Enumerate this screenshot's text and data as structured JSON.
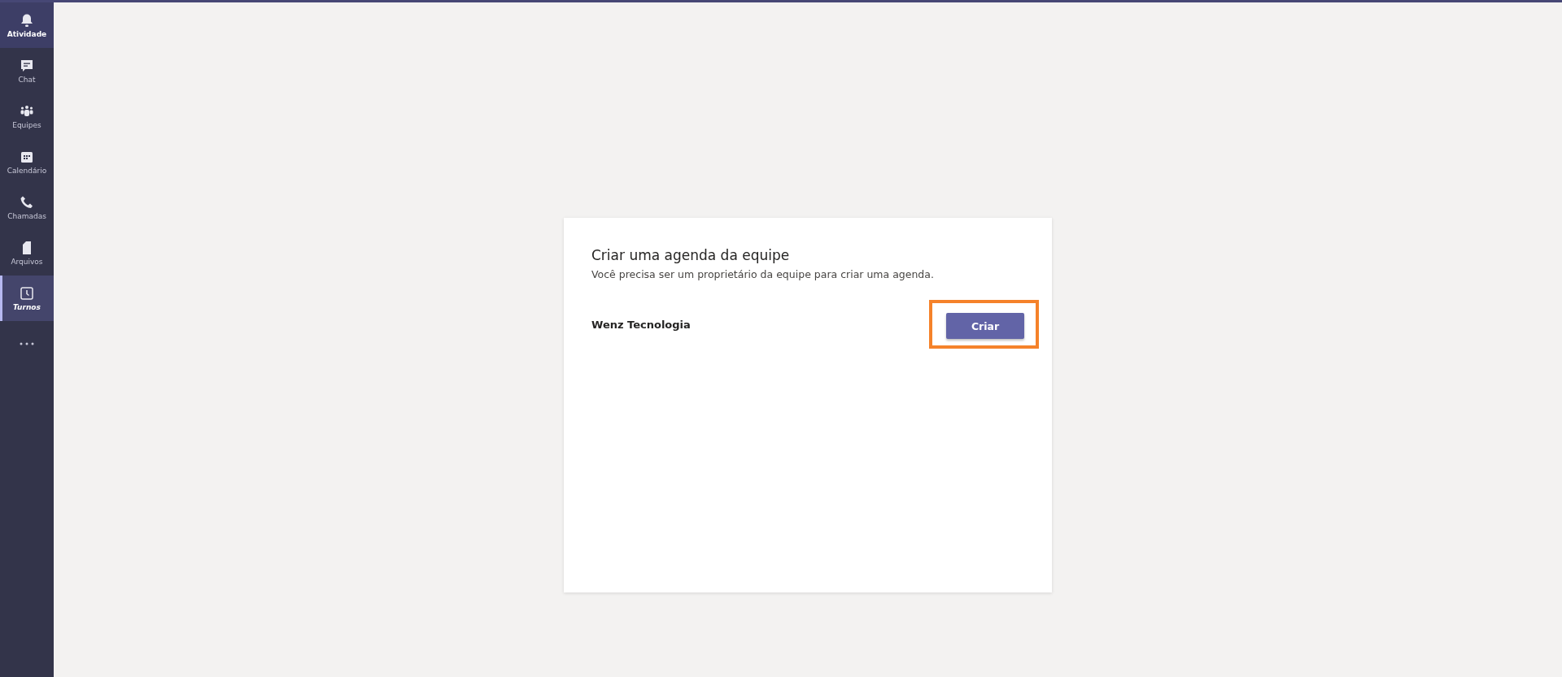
{
  "sidebar": {
    "items": [
      {
        "kind": "bell",
        "label": "Atividade",
        "selected": false,
        "hovered": true
      },
      {
        "kind": "chat",
        "label": "Chat",
        "selected": false,
        "hovered": false
      },
      {
        "kind": "teams",
        "label": "Equipes",
        "selected": false,
        "hovered": false
      },
      {
        "kind": "calendar",
        "label": "Calendário",
        "selected": false,
        "hovered": false
      },
      {
        "kind": "phone",
        "label": "Chamadas",
        "selected": false,
        "hovered": false
      },
      {
        "kind": "file",
        "label": "Arquivos",
        "selected": false,
        "hovered": false
      },
      {
        "kind": "clock",
        "label": "Turnos",
        "selected": true,
        "hovered": false
      }
    ]
  },
  "card": {
    "title": "Criar uma agenda da equipe",
    "subtitle": "Você precisa ser um proprietário da equipe para criar uma agenda.",
    "team": "Wenz Tecnologia",
    "button": {
      "label": "Criar",
      "highlighted": true
    }
  }
}
